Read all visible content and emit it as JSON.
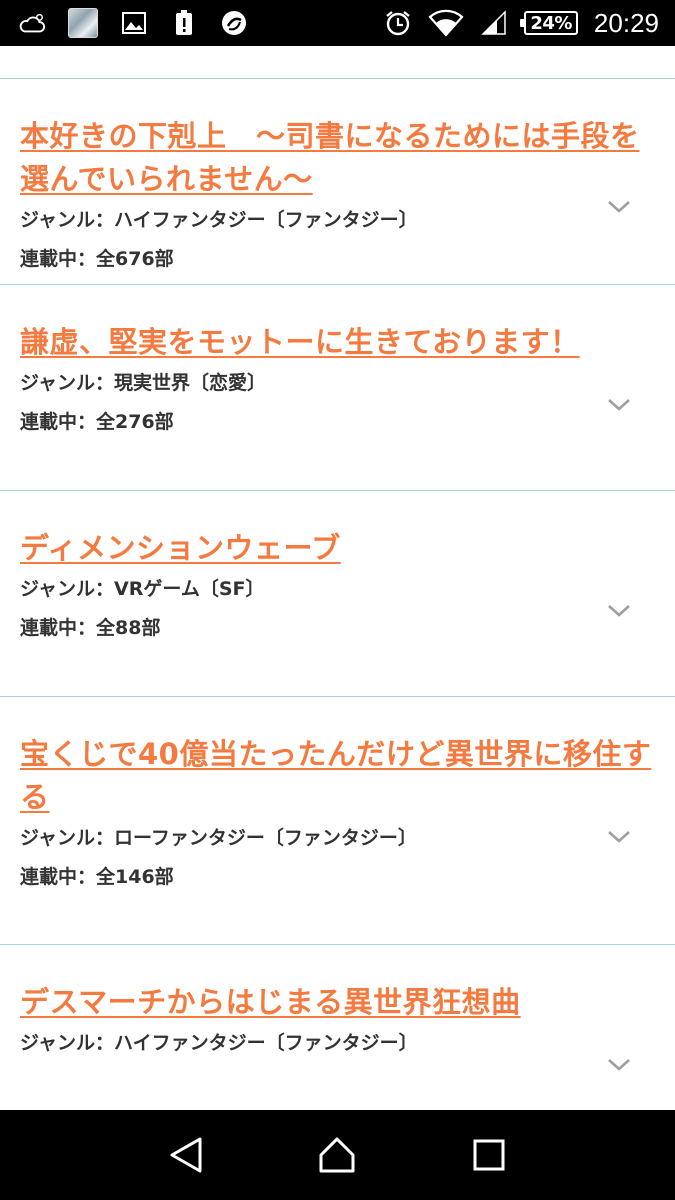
{
  "status_bar": {
    "battery": "24%",
    "time": "20:29",
    "icons": [
      "weather-cloud-icon",
      "app-avatar-icon",
      "gallery-icon",
      "alert-icon",
      "sync-app-icon",
      "alarm-icon",
      "wifi-icon",
      "signal-icon"
    ]
  },
  "novels": [
    {
      "title": "本好きの下剋上　～司書になるためには手段を選んでいられません～",
      "genre": "ジャンル：ハイファンタジー〔ファンタジー〕",
      "status": "連載中：全676部"
    },
    {
      "title": "謙虚、堅実をモットーに生きております！",
      "genre": "ジャンル：現実世界〔恋愛〕",
      "status": "連載中：全276部"
    },
    {
      "title": "ディメンションウェーブ",
      "genre": "ジャンル：VRゲーム〔SF〕",
      "status": "連載中：全88部"
    },
    {
      "title": "宝くじで40億当たったんだけど異世界に移住する",
      "genre": "ジャンル：ローファンタジー〔ファンタジー〕",
      "status": "連載中：全146部"
    },
    {
      "title": "デスマーチからはじまる異世界狂想曲",
      "genre": "ジャンル：ハイファンタジー〔ファンタジー〕",
      "status": ""
    }
  ],
  "colors": {
    "title_orange": "#f47a3f",
    "divider": "#a9d4dc",
    "meta_text": "#333333"
  },
  "nav_bar": {
    "icons": [
      "back-icon",
      "home-icon",
      "recents-icon"
    ]
  }
}
